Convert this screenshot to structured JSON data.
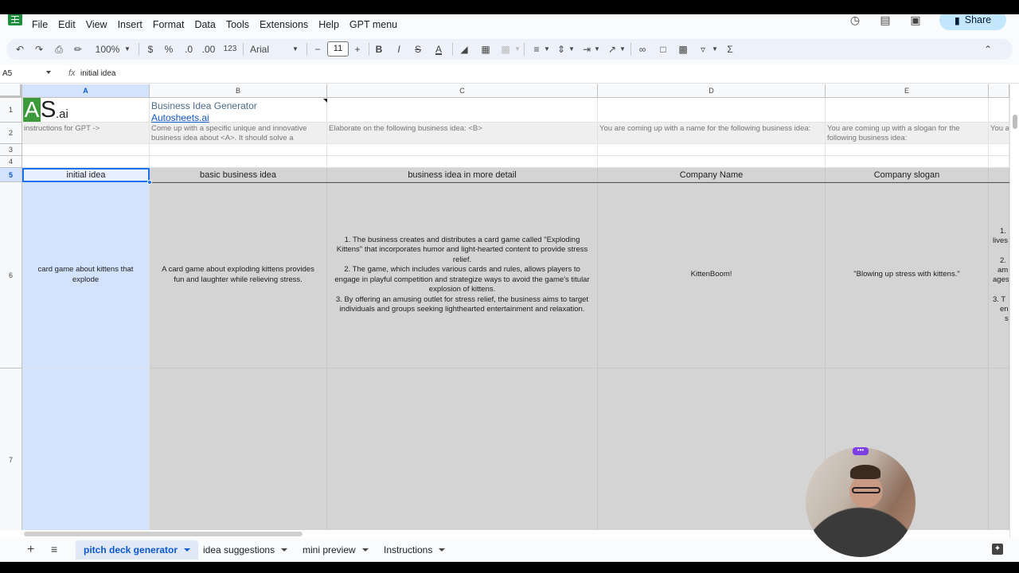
{
  "menu": [
    "File",
    "Edit",
    "View",
    "Insert",
    "Format",
    "Data",
    "Tools",
    "Extensions",
    "Help",
    "GPT menu"
  ],
  "share_label": "Share",
  "toolbar": {
    "zoom": "100%",
    "currency": "$",
    "percent": "%",
    "dec_decrease": ".0",
    "dec_increase": ".00",
    "number_format": "123",
    "font": "Arial",
    "font_size": "11",
    "minus": "−",
    "plus": "+",
    "bold": "B",
    "italic": "I",
    "strike": "S",
    "text_color": "A",
    "sigma": "Σ"
  },
  "formula_bar": {
    "cell_ref": "A5",
    "fx": "fx",
    "value": "initial idea"
  },
  "columns": [
    "A",
    "B",
    "C",
    "D",
    "E"
  ],
  "rows": [
    "1",
    "2",
    "3",
    "4",
    "5",
    "6",
    "7"
  ],
  "row1": {
    "logo_main": "S",
    "logo_a": "A",
    "logo_ai": ".ai",
    "title": "Business Idea Generator",
    "link": "Autosheets.ai"
  },
  "row2": {
    "a": "instructions for GPT ->",
    "b": "Come up with a specific unique and innovative business idea about <A>. It should solve a",
    "c": "Elaborate on the following business idea: <B>",
    "d": "You are coming up with a name for the following business idea:",
    "e": "You are coming up with a slogan for the following business idea:",
    "f": "You a for a"
  },
  "row5": {
    "a": "initial idea",
    "b": "basic business idea",
    "c": "business idea in more detail",
    "d": "Company Name",
    "e": "Company slogan"
  },
  "row6": {
    "a": "card game about kittens that explode",
    "b": "A card game about exploding kittens provides fun and laughter while relieving stress.",
    "c1": "1. The business creates and distributes a card game called \"Exploding Kittens\" that incorporates humor and light-hearted content to provide stress relief.",
    "c2": "2. The game, which includes various cards and rules, allows players to engage in playful competition and strategize ways to avoid the game's titular explosion of kittens.",
    "c3": "3. By offering an amusing outlet for stress relief, the business aims to target individuals and groups seeking lighthearted entertainment and relaxation.",
    "d": "KittenBoom!",
    "e": "\"Blowing up stress with kittens.\"",
    "f1": "1.",
    "f1b": "lives",
    "f2": "2.",
    "f2b": "am",
    "f2c": "ages",
    "f3": "3. T",
    "f3b": "en",
    "f3c": "s"
  },
  "tabs": [
    "pitch deck generator",
    "idea suggestions",
    "mini preview",
    "Instructions"
  ],
  "webcam_dots": "•••"
}
